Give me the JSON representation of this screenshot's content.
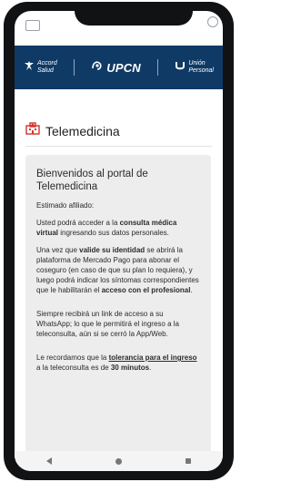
{
  "header": {
    "brand_accord_line1": "Accord",
    "brand_accord_line2": "Salud",
    "brand_upcn": "UPCN",
    "brand_union_line1": "Unión",
    "brand_union_line2": "Personal"
  },
  "page": {
    "title": "Telemedicina"
  },
  "card": {
    "heading": "Bienvenidos al portal de Telemedicina",
    "greeting": "Estimado afiliado:",
    "p1_a": "Usted podrá acceder a la ",
    "p1_b": "consulta médica virtual",
    "p1_c": " ingresando sus datos personales.",
    "p2_a": "Una vez que ",
    "p2_b": "valide su identidad",
    "p2_c": " se abrirá la plataforma de Mercado Pago para abonar el coseguro (en caso de que su plan lo requiera), y luego podrá indicar los síntomas correspondientes que le habilitarán el ",
    "p2_d": "acceso con el profesional",
    "p2_e": ".",
    "p3": "Siempre recibirá un link de acceso a su WhatsApp; lo que le permitirá el ingreso a la teleconsulta, aún si se cerró la App/Web.",
    "p4_a": "Le recordamos que la ",
    "p4_b": "tolerancia para el ingreso",
    "p4_c": " a la teleconsulta es de ",
    "p4_d": "30 minutos",
    "p4_e": "."
  },
  "colors": {
    "header_bg": "#0f3a66",
    "accent_red": "#d9302c",
    "card_bg": "#ededed"
  },
  "icons": {
    "title_icon": "hospital-icon",
    "nav": [
      "back-icon",
      "home-icon",
      "recent-apps-icon"
    ]
  }
}
